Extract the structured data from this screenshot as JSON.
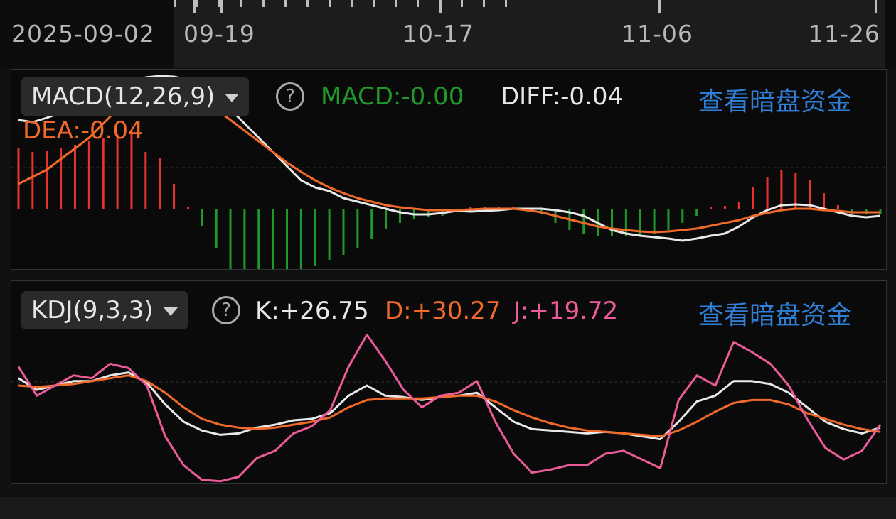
{
  "colors": {
    "up": "#e8332d",
    "down": "#1f9a2a",
    "diff": "#e8e8e8",
    "dea": "#f26a2a",
    "k": "#e8e8e8",
    "d": "#f26a2a",
    "j": "#ec5b9a",
    "link": "#2f7fd6",
    "macd_value": "#1f9a2a"
  },
  "timeline": {
    "dates": [
      "2025-09-02",
      "09-19",
      "10-17",
      "11-06",
      "11-26"
    ]
  },
  "macd_panel": {
    "selector_label": "MACD(12,26,9)",
    "help_icon": "question-circle-icon",
    "macd_value": "MACD:-0.00",
    "diff_value": "DIFF:-0.04",
    "dea_value": "DEA:-0.04",
    "link_text": "查看暗盘资金"
  },
  "kdj_panel": {
    "selector_label": "KDJ(9,3,3)",
    "help_icon": "question-circle-icon",
    "k_value": "K:+26.75",
    "d_value": "D:+30.27",
    "j_value": "J:+19.72",
    "link_text": "查看暗盘资金"
  },
  "chart_data": [
    {
      "type": "bar",
      "name": "MACD histogram",
      "values": [
        0.85,
        0.8,
        0.82,
        0.86,
        0.9,
        0.95,
        1.0,
        1.05,
        1.1,
        0.8,
        0.72,
        0.35,
        0.02,
        -0.25,
        -0.55,
        -0.85,
        -1.05,
        -1.15,
        -1.05,
        -0.95,
        -0.85,
        -0.8,
        -0.72,
        -0.65,
        -0.55,
        -0.42,
        -0.28,
        -0.2,
        -0.15,
        -0.12,
        -0.1,
        -0.05,
        0,
        0,
        0,
        0,
        -0.05,
        -0.08,
        -0.2,
        -0.3,
        -0.35,
        -0.38,
        -0.38,
        -0.38,
        -0.38,
        -0.35,
        -0.3,
        -0.2,
        -0.1,
        0,
        0.04,
        0.1,
        0.3,
        0.45,
        0.55,
        0.5,
        0.4,
        0.22,
        0.05,
        -0.08,
        -0.08,
        -0.07
      ],
      "series": [
        {
          "name": "DIFF",
          "values": [
            1.25,
            1.22,
            1.28,
            1.35,
            1.42,
            1.5,
            1.6,
            1.7,
            1.78,
            1.85,
            1.87,
            1.86,
            1.82,
            1.7,
            1.55,
            1.4,
            1.2,
            1.0,
            0.8,
            0.6,
            0.4,
            0.3,
            0.25,
            0.15,
            0.1,
            0.05,
            0.0,
            -0.05,
            -0.08,
            -0.08,
            -0.06,
            -0.03,
            -0.04,
            -0.03,
            -0.02,
            0.0,
            0.0,
            0.0,
            -0.02,
            -0.05,
            -0.1,
            -0.2,
            -0.3,
            -0.35,
            -0.38,
            -0.4,
            -0.42,
            -0.45,
            -0.42,
            -0.38,
            -0.35,
            -0.25,
            -0.12,
            -0.02,
            0.05,
            0.06,
            0.05,
            0.0,
            -0.05,
            -0.1,
            -0.12,
            -0.1
          ]
        },
        {
          "name": "DEA",
          "values": [
            0.35,
            0.45,
            0.55,
            0.7,
            0.85,
            1.0,
            1.2,
            1.4,
            1.55,
            1.68,
            1.72,
            1.7,
            1.65,
            1.55,
            1.4,
            1.25,
            1.1,
            0.95,
            0.8,
            0.65,
            0.52,
            0.4,
            0.3,
            0.22,
            0.15,
            0.1,
            0.05,
            0.02,
            0.0,
            -0.02,
            -0.02,
            -0.02,
            -0.01,
            0.0,
            0.0,
            0.0,
            -0.02,
            -0.05,
            -0.1,
            -0.15,
            -0.2,
            -0.25,
            -0.28,
            -0.3,
            -0.32,
            -0.33,
            -0.32,
            -0.3,
            -0.28,
            -0.24,
            -0.2,
            -0.16,
            -0.1,
            -0.06,
            -0.02,
            0.0,
            0.0,
            -0.02,
            -0.03,
            -0.05,
            -0.05,
            -0.05
          ]
        }
      ]
    },
    {
      "type": "line",
      "name": "KDJ",
      "series": [
        {
          "name": "K",
          "values": [
            60,
            52,
            55,
            58,
            58,
            62,
            64,
            57,
            42,
            30,
            24,
            21,
            22,
            26,
            28,
            31,
            32,
            36,
            48,
            55,
            48,
            47,
            45,
            47,
            48,
            50,
            40,
            30,
            25,
            24,
            23,
            22,
            23,
            22,
            20,
            18,
            30,
            44,
            48,
            58,
            58,
            56,
            50,
            40,
            30,
            25,
            22,
            26
          ]
        },
        {
          "name": "D",
          "values": [
            55,
            54,
            55,
            56,
            58,
            60,
            62,
            58,
            50,
            40,
            32,
            28,
            26,
            25,
            26,
            28,
            30,
            33,
            40,
            45,
            46,
            46,
            46,
            47,
            48,
            48,
            44,
            38,
            33,
            29,
            26,
            24,
            23,
            22,
            21,
            20,
            24,
            30,
            37,
            43,
            45,
            45,
            42,
            36,
            32,
            28,
            25,
            23
          ]
        },
        {
          "name": "J",
          "values": [
            68,
            48,
            55,
            62,
            60,
            70,
            67,
            55,
            20,
            0,
            -10,
            -11,
            -8,
            5,
            10,
            22,
            27,
            38,
            68,
            90,
            72,
            52,
            40,
            48,
            50,
            58,
            30,
            8,
            -5,
            -3,
            0,
            0,
            8,
            10,
            4,
            -2,
            45,
            62,
            55,
            85,
            78,
            70,
            55,
            32,
            12,
            4,
            10,
            28
          ]
        }
      ]
    }
  ]
}
